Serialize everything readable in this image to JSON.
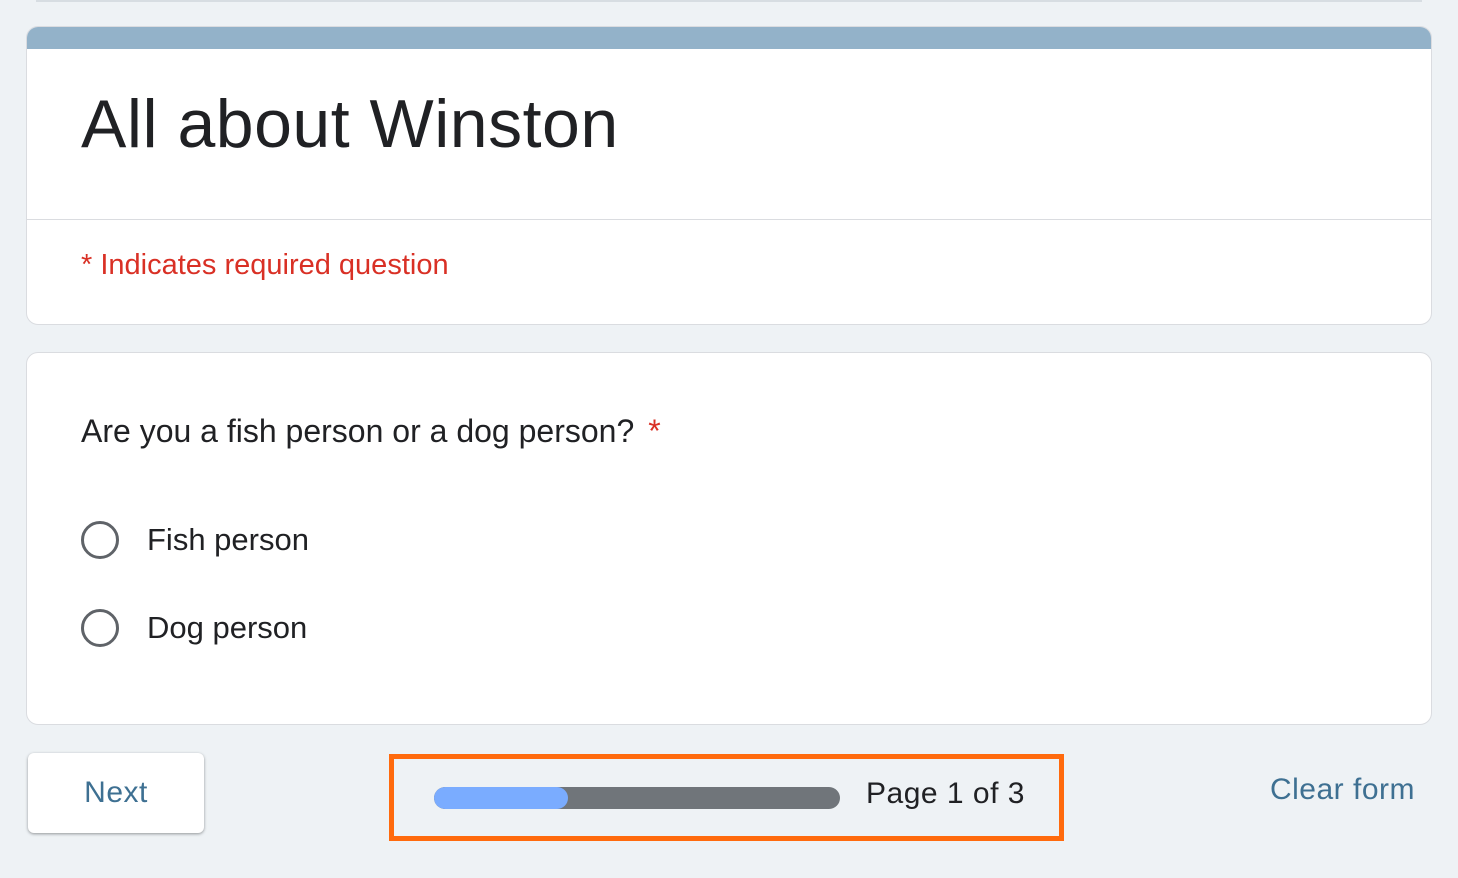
{
  "form": {
    "title": "All about Winston",
    "required_note": "* Indicates required question",
    "accent_color": "#93b2c9"
  },
  "question": {
    "text": "Are you a fish person or a dog person?",
    "required_marker": "*",
    "options": [
      {
        "label": "Fish person",
        "selected": false
      },
      {
        "label": "Dog person",
        "selected": false
      }
    ]
  },
  "footer": {
    "next_label": "Next",
    "progress": {
      "current_page": 1,
      "total_pages": 3,
      "fraction": 0.33,
      "label": "Page 1 of 3",
      "fill_color": "#7aacff",
      "track_color": "#70757a"
    },
    "clear_label": "Clear form",
    "highlight_color": "#ff6a0d"
  }
}
